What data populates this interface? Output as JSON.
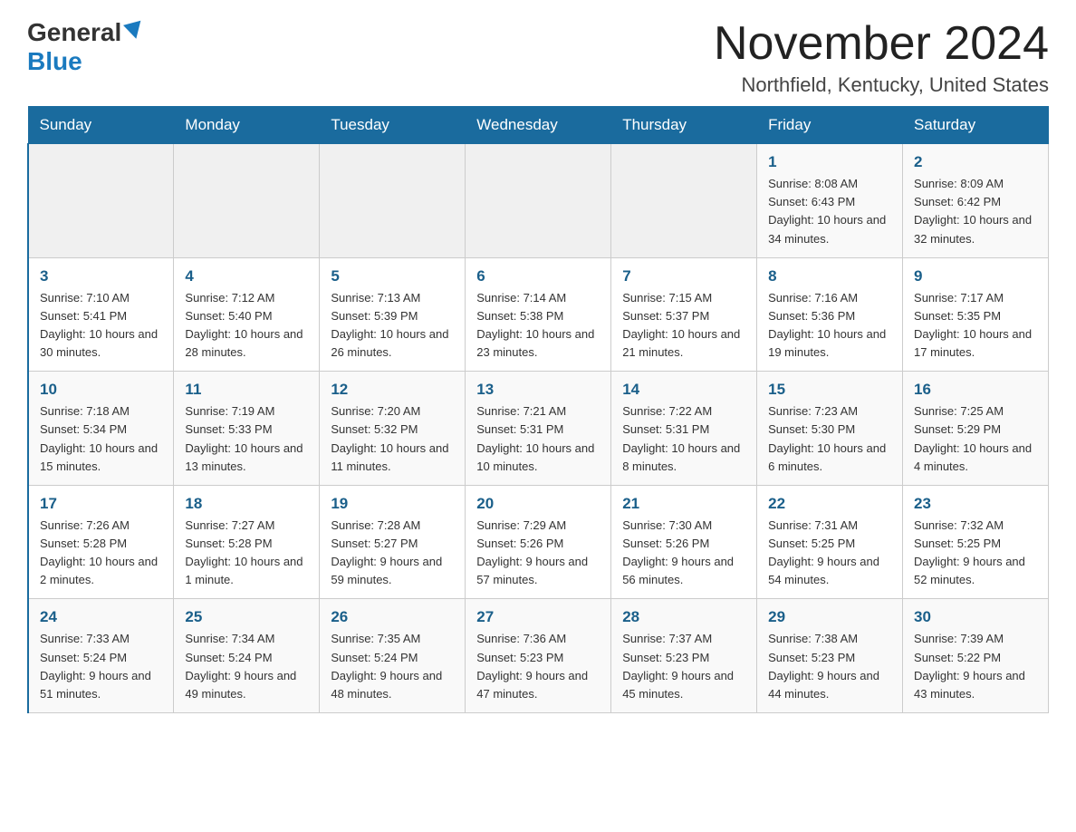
{
  "header": {
    "logo_general": "General",
    "logo_blue": "Blue",
    "month_title": "November 2024",
    "location": "Northfield, Kentucky, United States"
  },
  "days_of_week": [
    "Sunday",
    "Monday",
    "Tuesday",
    "Wednesday",
    "Thursday",
    "Friday",
    "Saturday"
  ],
  "weeks": [
    [
      {
        "day": "",
        "info": ""
      },
      {
        "day": "",
        "info": ""
      },
      {
        "day": "",
        "info": ""
      },
      {
        "day": "",
        "info": ""
      },
      {
        "day": "",
        "info": ""
      },
      {
        "day": "1",
        "info": "Sunrise: 8:08 AM\nSunset: 6:43 PM\nDaylight: 10 hours and 34 minutes."
      },
      {
        "day": "2",
        "info": "Sunrise: 8:09 AM\nSunset: 6:42 PM\nDaylight: 10 hours and 32 minutes."
      }
    ],
    [
      {
        "day": "3",
        "info": "Sunrise: 7:10 AM\nSunset: 5:41 PM\nDaylight: 10 hours and 30 minutes."
      },
      {
        "day": "4",
        "info": "Sunrise: 7:12 AM\nSunset: 5:40 PM\nDaylight: 10 hours and 28 minutes."
      },
      {
        "day": "5",
        "info": "Sunrise: 7:13 AM\nSunset: 5:39 PM\nDaylight: 10 hours and 26 minutes."
      },
      {
        "day": "6",
        "info": "Sunrise: 7:14 AM\nSunset: 5:38 PM\nDaylight: 10 hours and 23 minutes."
      },
      {
        "day": "7",
        "info": "Sunrise: 7:15 AM\nSunset: 5:37 PM\nDaylight: 10 hours and 21 minutes."
      },
      {
        "day": "8",
        "info": "Sunrise: 7:16 AM\nSunset: 5:36 PM\nDaylight: 10 hours and 19 minutes."
      },
      {
        "day": "9",
        "info": "Sunrise: 7:17 AM\nSunset: 5:35 PM\nDaylight: 10 hours and 17 minutes."
      }
    ],
    [
      {
        "day": "10",
        "info": "Sunrise: 7:18 AM\nSunset: 5:34 PM\nDaylight: 10 hours and 15 minutes."
      },
      {
        "day": "11",
        "info": "Sunrise: 7:19 AM\nSunset: 5:33 PM\nDaylight: 10 hours and 13 minutes."
      },
      {
        "day": "12",
        "info": "Sunrise: 7:20 AM\nSunset: 5:32 PM\nDaylight: 10 hours and 11 minutes."
      },
      {
        "day": "13",
        "info": "Sunrise: 7:21 AM\nSunset: 5:31 PM\nDaylight: 10 hours and 10 minutes."
      },
      {
        "day": "14",
        "info": "Sunrise: 7:22 AM\nSunset: 5:31 PM\nDaylight: 10 hours and 8 minutes."
      },
      {
        "day": "15",
        "info": "Sunrise: 7:23 AM\nSunset: 5:30 PM\nDaylight: 10 hours and 6 minutes."
      },
      {
        "day": "16",
        "info": "Sunrise: 7:25 AM\nSunset: 5:29 PM\nDaylight: 10 hours and 4 minutes."
      }
    ],
    [
      {
        "day": "17",
        "info": "Sunrise: 7:26 AM\nSunset: 5:28 PM\nDaylight: 10 hours and 2 minutes."
      },
      {
        "day": "18",
        "info": "Sunrise: 7:27 AM\nSunset: 5:28 PM\nDaylight: 10 hours and 1 minute."
      },
      {
        "day": "19",
        "info": "Sunrise: 7:28 AM\nSunset: 5:27 PM\nDaylight: 9 hours and 59 minutes."
      },
      {
        "day": "20",
        "info": "Sunrise: 7:29 AM\nSunset: 5:26 PM\nDaylight: 9 hours and 57 minutes."
      },
      {
        "day": "21",
        "info": "Sunrise: 7:30 AM\nSunset: 5:26 PM\nDaylight: 9 hours and 56 minutes."
      },
      {
        "day": "22",
        "info": "Sunrise: 7:31 AM\nSunset: 5:25 PM\nDaylight: 9 hours and 54 minutes."
      },
      {
        "day": "23",
        "info": "Sunrise: 7:32 AM\nSunset: 5:25 PM\nDaylight: 9 hours and 52 minutes."
      }
    ],
    [
      {
        "day": "24",
        "info": "Sunrise: 7:33 AM\nSunset: 5:24 PM\nDaylight: 9 hours and 51 minutes."
      },
      {
        "day": "25",
        "info": "Sunrise: 7:34 AM\nSunset: 5:24 PM\nDaylight: 9 hours and 49 minutes."
      },
      {
        "day": "26",
        "info": "Sunrise: 7:35 AM\nSunset: 5:24 PM\nDaylight: 9 hours and 48 minutes."
      },
      {
        "day": "27",
        "info": "Sunrise: 7:36 AM\nSunset: 5:23 PM\nDaylight: 9 hours and 47 minutes."
      },
      {
        "day": "28",
        "info": "Sunrise: 7:37 AM\nSunset: 5:23 PM\nDaylight: 9 hours and 45 minutes."
      },
      {
        "day": "29",
        "info": "Sunrise: 7:38 AM\nSunset: 5:23 PM\nDaylight: 9 hours and 44 minutes."
      },
      {
        "day": "30",
        "info": "Sunrise: 7:39 AM\nSunset: 5:22 PM\nDaylight: 9 hours and 43 minutes."
      }
    ]
  ]
}
